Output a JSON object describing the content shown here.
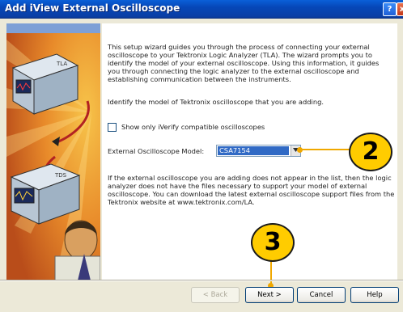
{
  "window": {
    "title": "Add iView External Oscilloscope",
    "help_button": "?",
    "close_button": "x"
  },
  "intro_text": "This setup wizard guides you through the process of connecting your external oscilloscope to your Tektronix Logic Analyzer (TLA). The wizard prompts you to identify the model of your external oscilloscope. Using this information, it guides you through connecting the logic analyzer to the external oscilloscope and establishing communication between the instruments.",
  "identify_text": "Identify the model of Tektronix oscilloscope that you are adding.",
  "checkbox": {
    "label": "Show only iVerify compatible oscilloscopes",
    "checked": false
  },
  "model": {
    "label": "External Oscilloscope Model:",
    "value": "CSA7154"
  },
  "note_text": "If the external oscilloscope you are adding does not appear in the list, then the logic analyzer does not have the files necessary to support your model of external oscilloscope. You can download the latest external oscilloscope support files from the Tektronix website at www.tektronix.com/LA.",
  "buttons": {
    "back": "< Back",
    "next": "Next >",
    "cancel": "Cancel",
    "help": "Help"
  },
  "callouts": {
    "model_callout": "2",
    "next_callout": "3"
  },
  "art": {
    "top_device_label": "TLA",
    "bottom_device_label": "TDS"
  },
  "colors": {
    "titlebar": "#0a5fd8",
    "callout_fill": "#ffcc00",
    "selection": "#316ac5",
    "dialog_bg": "#ece9d8"
  }
}
